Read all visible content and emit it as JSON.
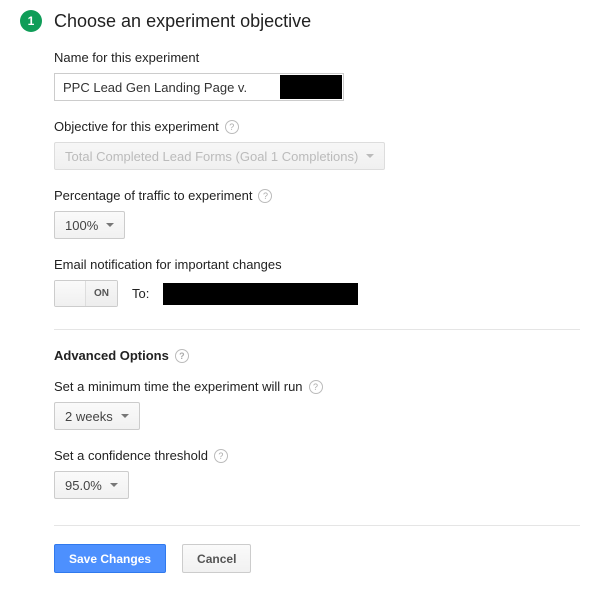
{
  "step": "1",
  "title": "Choose an experiment objective",
  "fields": {
    "name": {
      "label": "Name for this experiment",
      "value": "PPC Lead Gen Landing Page v."
    },
    "objective": {
      "label": "Objective for this experiment",
      "selected": "Total Completed Lead Forms (Goal 1 Completions)"
    },
    "traffic": {
      "label": "Percentage of traffic to experiment",
      "selected": "100%"
    },
    "email": {
      "label": "Email notification for important changes",
      "toggle_on": "ON",
      "to_label": "To:"
    }
  },
  "advanced": {
    "heading": "Advanced Options",
    "min_time": {
      "label": "Set a minimum time the experiment will run",
      "selected": "2 weeks"
    },
    "confidence": {
      "label": "Set a confidence threshold",
      "selected": "95.0%"
    }
  },
  "buttons": {
    "save": "Save Changes",
    "cancel": "Cancel"
  }
}
